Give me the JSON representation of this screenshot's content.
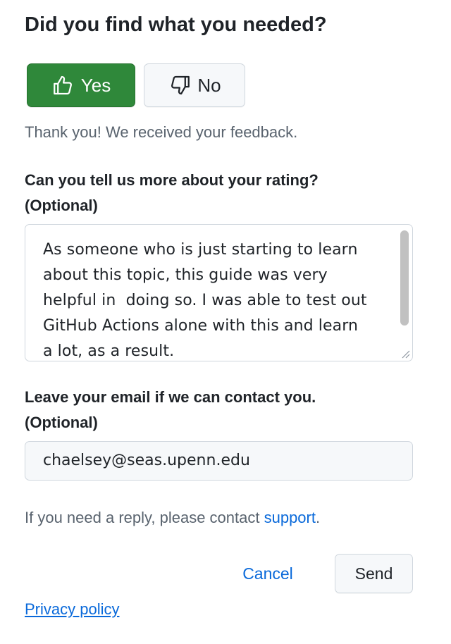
{
  "feedback": {
    "title": "Did you find what you needed?",
    "yes_label": "Yes",
    "no_label": "No",
    "selected": "Yes",
    "thanks_message": "Thank you! We received your feedback.",
    "rating_label_line1": "Can you tell us more about your rating?",
    "rating_label_line2": "(Optional)",
    "rating_text": "As someone who is just starting to learn\nabout this topic, this guide was very\nhelpful in  doing so. I was able to test out\nGitHub Actions alone with this and learn\na lot, as a result.",
    "email_label_line1": "Leave your email if we can contact you.",
    "email_label_line2": "(Optional)",
    "email_value": "chaelsey@seas.upenn.edu",
    "reply_note_prefix": "If you need a reply, please contact ",
    "reply_note_link": "support",
    "reply_note_suffix": ".",
    "cancel_label": "Cancel",
    "send_label": "Send",
    "privacy_label": "Privacy policy"
  },
  "icons": {
    "yes": "thumbs-up-icon",
    "no": "thumbs-down-icon"
  },
  "colors": {
    "yes_button_bg": "#2f883a",
    "link": "#0969da",
    "muted_text": "#59636e",
    "border": "#d0d7de"
  }
}
